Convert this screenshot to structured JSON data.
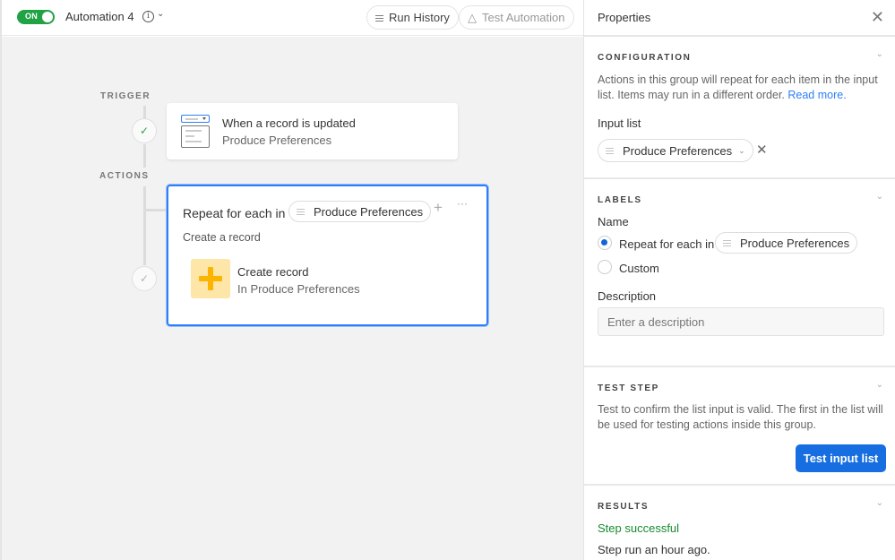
{
  "header": {
    "toggle_label": "ON",
    "toggle_state": "on",
    "automation_name": "Automation 4",
    "run_history_label": "Run History",
    "test_automation_label": "Test Automation"
  },
  "canvas": {
    "trigger_label": "TRIGGER",
    "actions_label": "ACTIONS",
    "trigger_card": {
      "title": "When a record is updated",
      "subtitle": "Produce Preferences",
      "status": "success"
    },
    "repeat_card": {
      "title": "Repeat for each in",
      "list_chip": "Produce Preferences",
      "subtitle": "Create a record",
      "action": {
        "title": "Create record",
        "subtitle": "In Produce Preferences"
      },
      "status": "pending"
    }
  },
  "panel": {
    "title": "Properties",
    "configuration": {
      "heading": "CONFIGURATION",
      "description": "Actions in this group will repeat for each item in the input list. Items may run in a different order.",
      "link": "Read more.",
      "input_list_label": "Input list",
      "input_list_value": "Produce Preferences"
    },
    "labels": {
      "heading": "LABELS",
      "name_label": "Name",
      "option_default": "Repeat for each in",
      "option_default_chip": "Produce Preferences",
      "option_custom": "Custom",
      "selected": "default",
      "description_label": "Description",
      "description_placeholder": "Enter a description",
      "description_value": ""
    },
    "test_step": {
      "heading": "TEST STEP",
      "description": "Test to confirm the list input is valid. The first in the list will be used for testing actions inside this group.",
      "button": "Test input list"
    },
    "results": {
      "heading": "RESULTS",
      "status": "Step successful",
      "time": "Step run an hour ago."
    }
  },
  "colors": {
    "accent": "#166ee1",
    "selection": "#2d7ff9",
    "success": "#168a2f",
    "toggle_on": "#20a245",
    "create_icon_bg": "#fee5a8",
    "create_icon_fg": "#fcb400"
  }
}
